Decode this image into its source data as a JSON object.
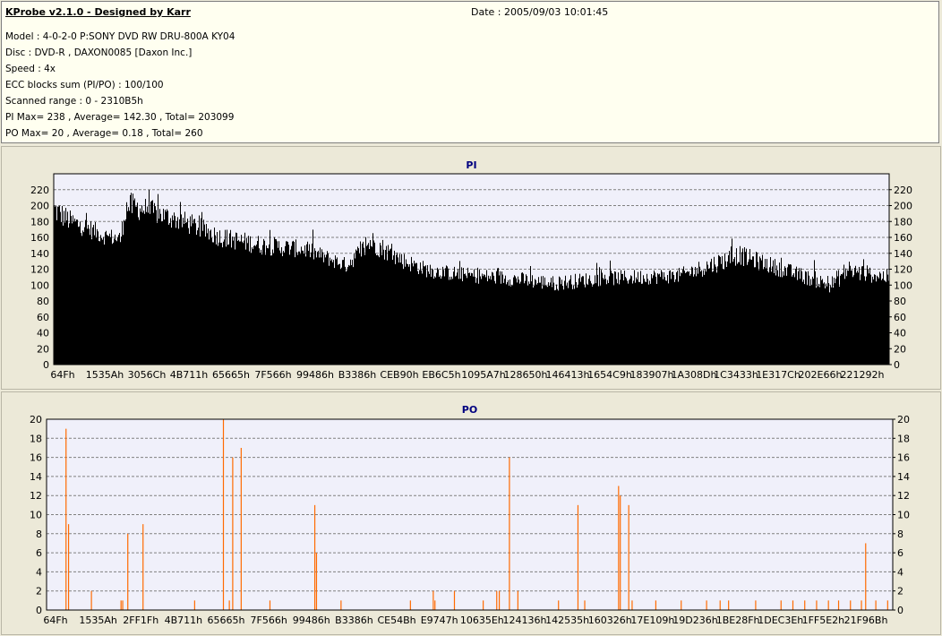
{
  "header": {
    "title": "KProbe v2.1.0 - Designed by Karr",
    "date": "Date : 2005/09/03 10:01:45",
    "lines": [
      "Model : 4-0-2-0 P:SONY    DVD RW DRU-800A  KY04",
      "Disc : DVD-R , DAXON0085 [Daxon Inc.]",
      "Speed : 4x",
      "ECC blocks sum (PI/PO) : 100/100",
      "Scanned range : 0 - 2310B5h",
      "PI Max= 238 , Average= 142.30 , Total= 203099",
      "PO Max= 20 , Average= 0.18 , Total= 260"
    ]
  },
  "chart_data": [
    {
      "type": "bar",
      "title": "PI",
      "ylim": [
        0,
        240
      ],
      "yticks": [
        0,
        20,
        40,
        60,
        80,
        100,
        120,
        140,
        160,
        180,
        200,
        220
      ],
      "xticks": [
        "64Fh",
        "1535Ah",
        "3056Ch",
        "4B711h",
        "65665h",
        "7F566h",
        "99486h",
        "B3386h",
        "CEB90h",
        "EB6C5h",
        "1095A7h",
        "128650h",
        "146413h",
        "1654C9h",
        "183907h",
        "1A308Dh",
        "1C3433h",
        "1E317Ch",
        "202E66h",
        "221292h"
      ],
      "grid": true,
      "color": "#000000",
      "max": 238,
      "average": 142.3,
      "envelope": {
        "position": [
          0,
          0.02,
          0.04,
          0.06,
          0.08,
          0.085,
          0.09,
          0.11,
          0.13,
          0.16,
          0.2,
          0.25,
          0.3,
          0.35,
          0.38,
          0.4,
          0.42,
          0.45,
          0.5,
          0.55,
          0.6,
          0.65,
          0.7,
          0.75,
          0.8,
          0.82,
          0.85,
          0.9,
          0.93,
          0.95,
          0.97,
          1.0
        ],
        "base": [
          195,
          180,
          172,
          162,
          158,
          195,
          200,
          195,
          188,
          178,
          160,
          150,
          145,
          125,
          155,
          142,
          130,
          118,
          112,
          108,
          102,
          108,
          110,
          112,
          130,
          138,
          128,
          110,
          100,
          118,
          115,
          110
        ],
        "spread": [
          25,
          20,
          18,
          16,
          16,
          25,
          25,
          22,
          20,
          20,
          18,
          18,
          16,
          14,
          22,
          18,
          16,
          14,
          14,
          14,
          14,
          14,
          14,
          14,
          18,
          18,
          16,
          14,
          14,
          20,
          16,
          14
        ]
      }
    },
    {
      "type": "bar",
      "title": "PO",
      "ylim": [
        0,
        20
      ],
      "yticks": [
        0,
        2,
        4,
        6,
        8,
        10,
        12,
        14,
        16,
        18,
        20
      ],
      "xticks": [
        "64Fh",
        "1535Ah",
        "2FF1Fh",
        "4B711h",
        "65665h",
        "7F566h",
        "99486h",
        "B3386h",
        "CE54Bh",
        "E9747h",
        "10635Eh",
        "124136h",
        "142535h",
        "160326h",
        "17E109h",
        "19D236h",
        "1BE28Fh",
        "1DEC3Eh",
        "1FF5E2h",
        "21F96Bh"
      ],
      "grid": true,
      "color": "#ff6a00",
      "max": 20,
      "average": 0.18,
      "points": [
        {
          "x": 0.023,
          "y": 19
        },
        {
          "x": 0.026,
          "y": 9
        },
        {
          "x": 0.053,
          "y": 2
        },
        {
          "x": 0.088,
          "y": 1
        },
        {
          "x": 0.09,
          "y": 1
        },
        {
          "x": 0.096,
          "y": 8
        },
        {
          "x": 0.114,
          "y": 9
        },
        {
          "x": 0.175,
          "y": 1
        },
        {
          "x": 0.209,
          "y": 20
        },
        {
          "x": 0.216,
          "y": 1
        },
        {
          "x": 0.22,
          "y": 16
        },
        {
          "x": 0.23,
          "y": 17
        },
        {
          "x": 0.264,
          "y": 1
        },
        {
          "x": 0.317,
          "y": 11
        },
        {
          "x": 0.319,
          "y": 6
        },
        {
          "x": 0.348,
          "y": 1
        },
        {
          "x": 0.43,
          "y": 1
        },
        {
          "x": 0.457,
          "y": 2
        },
        {
          "x": 0.459,
          "y": 1
        },
        {
          "x": 0.482,
          "y": 2
        },
        {
          "x": 0.516,
          "y": 1
        },
        {
          "x": 0.532,
          "y": 2
        },
        {
          "x": 0.535,
          "y": 2
        },
        {
          "x": 0.547,
          "y": 16
        },
        {
          "x": 0.557,
          "y": 2
        },
        {
          "x": 0.605,
          "y": 1
        },
        {
          "x": 0.628,
          "y": 11
        },
        {
          "x": 0.636,
          "y": 1
        },
        {
          "x": 0.676,
          "y": 13
        },
        {
          "x": 0.678,
          "y": 12
        },
        {
          "x": 0.688,
          "y": 11
        },
        {
          "x": 0.692,
          "y": 1
        },
        {
          "x": 0.72,
          "y": 1
        },
        {
          "x": 0.75,
          "y": 1
        },
        {
          "x": 0.78,
          "y": 1
        },
        {
          "x": 0.796,
          "y": 1
        },
        {
          "x": 0.806,
          "y": 1
        },
        {
          "x": 0.838,
          "y": 1
        },
        {
          "x": 0.868,
          "y": 1
        },
        {
          "x": 0.882,
          "y": 1
        },
        {
          "x": 0.896,
          "y": 1
        },
        {
          "x": 0.91,
          "y": 1
        },
        {
          "x": 0.924,
          "y": 1
        },
        {
          "x": 0.936,
          "y": 1
        },
        {
          "x": 0.95,
          "y": 1
        },
        {
          "x": 0.963,
          "y": 1
        },
        {
          "x": 0.968,
          "y": 7
        },
        {
          "x": 0.98,
          "y": 1
        },
        {
          "x": 0.994,
          "y": 1
        }
      ]
    }
  ]
}
